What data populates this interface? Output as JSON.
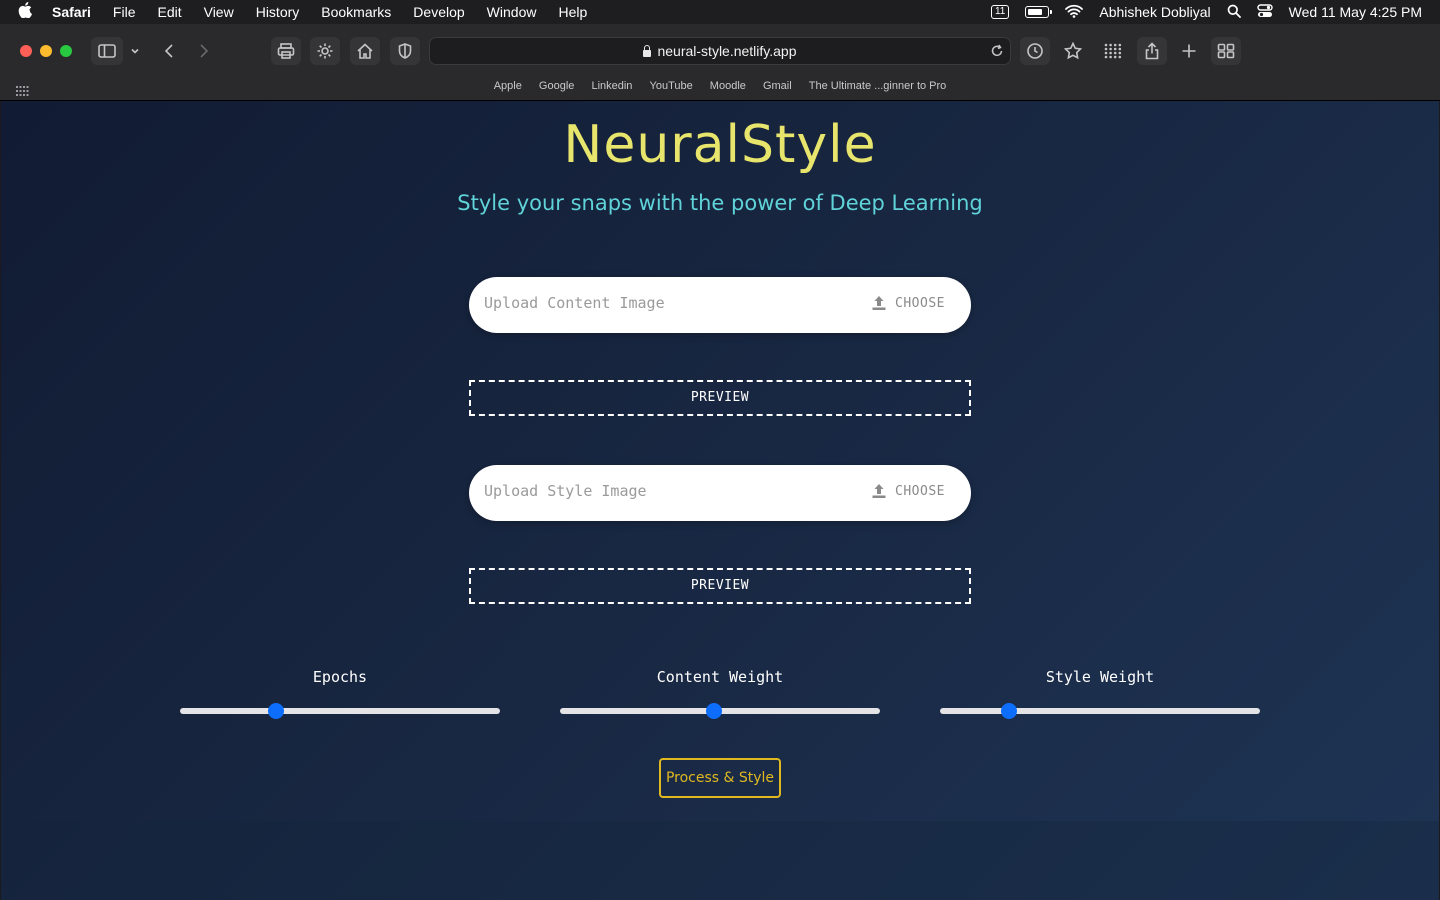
{
  "menubar": {
    "app_name": "Safari",
    "menus": [
      "File",
      "Edit",
      "View",
      "History",
      "Bookmarks",
      "Develop",
      "Window",
      "Help"
    ],
    "badge": "11",
    "user": "Abhishek Dobliyal",
    "datetime": "Wed 11 May  4:25 PM"
  },
  "browser": {
    "url": "neural-style.netlify.app",
    "bookmarks": [
      "Apple",
      "Google",
      "Linkedin",
      "YouTube",
      "Moodle",
      "Gmail",
      "The Ultimate ...ginner to Pro"
    ]
  },
  "page": {
    "title": "NeuralStyle",
    "subtitle": "Style your snaps with the power of Deep Learning",
    "content_upload": {
      "placeholder": "Upload Content Image",
      "choose_label": "CHOOSE"
    },
    "content_preview": "PREVIEW",
    "style_upload": {
      "placeholder": "Upload Style Image",
      "choose_label": "CHOOSE"
    },
    "style_preview": "PREVIEW",
    "sliders": [
      {
        "label": "Epochs",
        "value_fraction": 0.3
      },
      {
        "label": "Content Weight",
        "value_fraction": 0.48
      },
      {
        "label": "Style Weight",
        "value_fraction": 0.215
      }
    ],
    "process_button": "Process & Style"
  },
  "colors": {
    "title": "#e8e56c",
    "subtitle": "#5fd3d8",
    "accent_button": "#e0b820",
    "slider_knob": "#0d6efd"
  }
}
